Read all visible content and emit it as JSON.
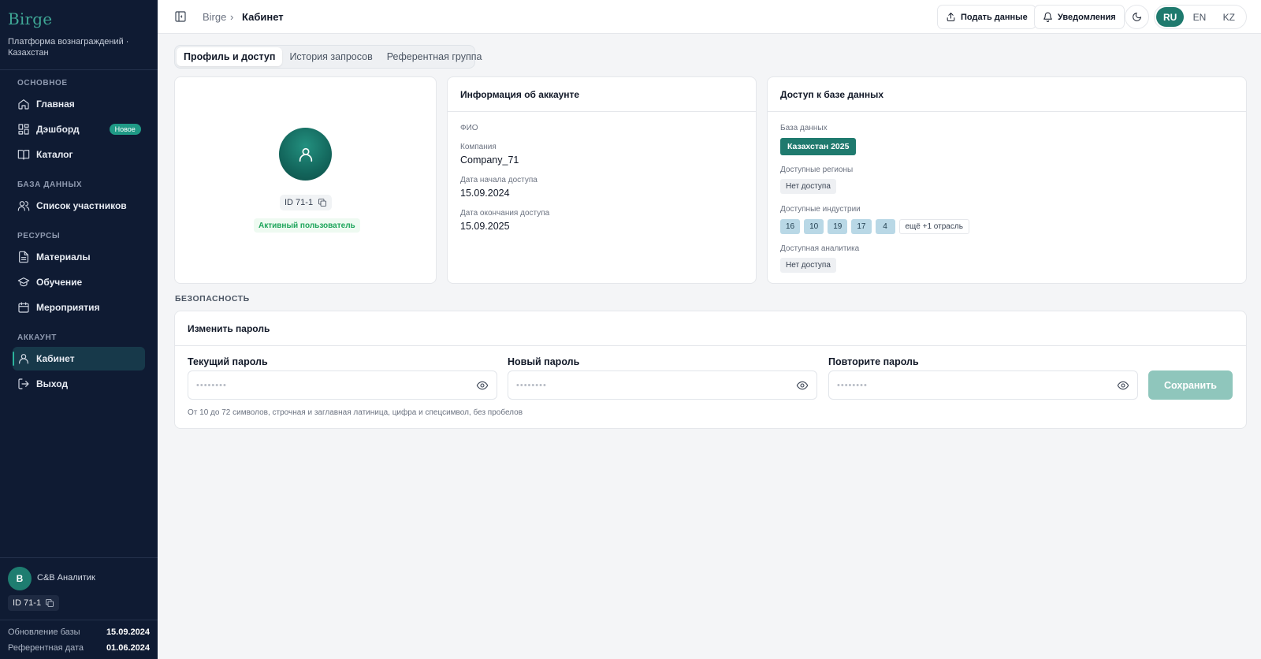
{
  "sidebar": {
    "logo": "Birge",
    "subtitle": "Платформа вознаграждений · Казахстан",
    "sections": {
      "main": "ОСНОВНОЕ",
      "database": "БАЗА ДАННЫХ",
      "resources": "РЕСУРСЫ",
      "account": "АККАУНТ"
    },
    "items": {
      "home": "Главная",
      "dashboard": "Дэшборд",
      "dashboard_badge": "Новое",
      "catalog": "Каталог",
      "participants": "Список участников",
      "materials": "Материалы",
      "learning": "Обучение",
      "events": "Мероприятия",
      "cabinet": "Кабинет",
      "logout": "Выход"
    },
    "user": {
      "initial": "B",
      "name": "C&B Аналитик",
      "id": "ID 71-1"
    },
    "meta": {
      "db_update_label": "Обновление базы",
      "db_update_value": "15.09.2024",
      "ref_date_label": "Референтная дата",
      "ref_date_value": "01.06.2024"
    }
  },
  "topbar": {
    "breadcrumb_root": "Birge",
    "breadcrumb_sep": "›",
    "breadcrumb_current": "Кабинет",
    "submit_label": "Подать данные",
    "notifications_label": "Уведомления",
    "languages": [
      "RU",
      "EN",
      "KZ"
    ],
    "active_language": "RU"
  },
  "tabs": [
    "Профиль и доступ",
    "История запросов",
    "Референтная группа"
  ],
  "profile": {
    "id": "ID 71-1",
    "status": "Активный пользователь"
  },
  "account_info": {
    "title": "Информация об аккаунте",
    "fio_label": "ФИО",
    "company_label": "Компания",
    "company_value": "Company_71",
    "start_label": "Дата начала доступа",
    "start_value": "15.09.2024",
    "end_label": "Дата окончания доступа",
    "end_value": "15.09.2025"
  },
  "db_access": {
    "title": "Доступ к базе данных",
    "db_label": "База данных",
    "db_value": "Казахстан 2025",
    "regions_label": "Доступные регионы",
    "regions_value": "Нет доступа",
    "industries_label": "Доступные индустрии",
    "industries": [
      "16",
      "10",
      "19",
      "17",
      "4"
    ],
    "industries_more": "ещё +1 отрасль",
    "analytics_label": "Доступная аналитика",
    "analytics_value": "Нет доступа"
  },
  "security": {
    "section_label": "БЕЗОПАСНОСТЬ",
    "card_title": "Изменить пароль",
    "current_label": "Текущий пароль",
    "new_label": "Новый пароль",
    "repeat_label": "Повторите пароль",
    "masked_value": "••••••••",
    "save_label": "Сохранить",
    "hint": "От 10 до 72 символов, строчная и заглавная латиница, цифра и спецсимвол, без пробелов"
  },
  "colors": {
    "sidebar_bg": "#0f1b33",
    "accent": "#1f7a6e",
    "save_disabled": "#8fc6bc",
    "status_green": "#1ea55b",
    "industry_chip": "#b9d8e6"
  }
}
